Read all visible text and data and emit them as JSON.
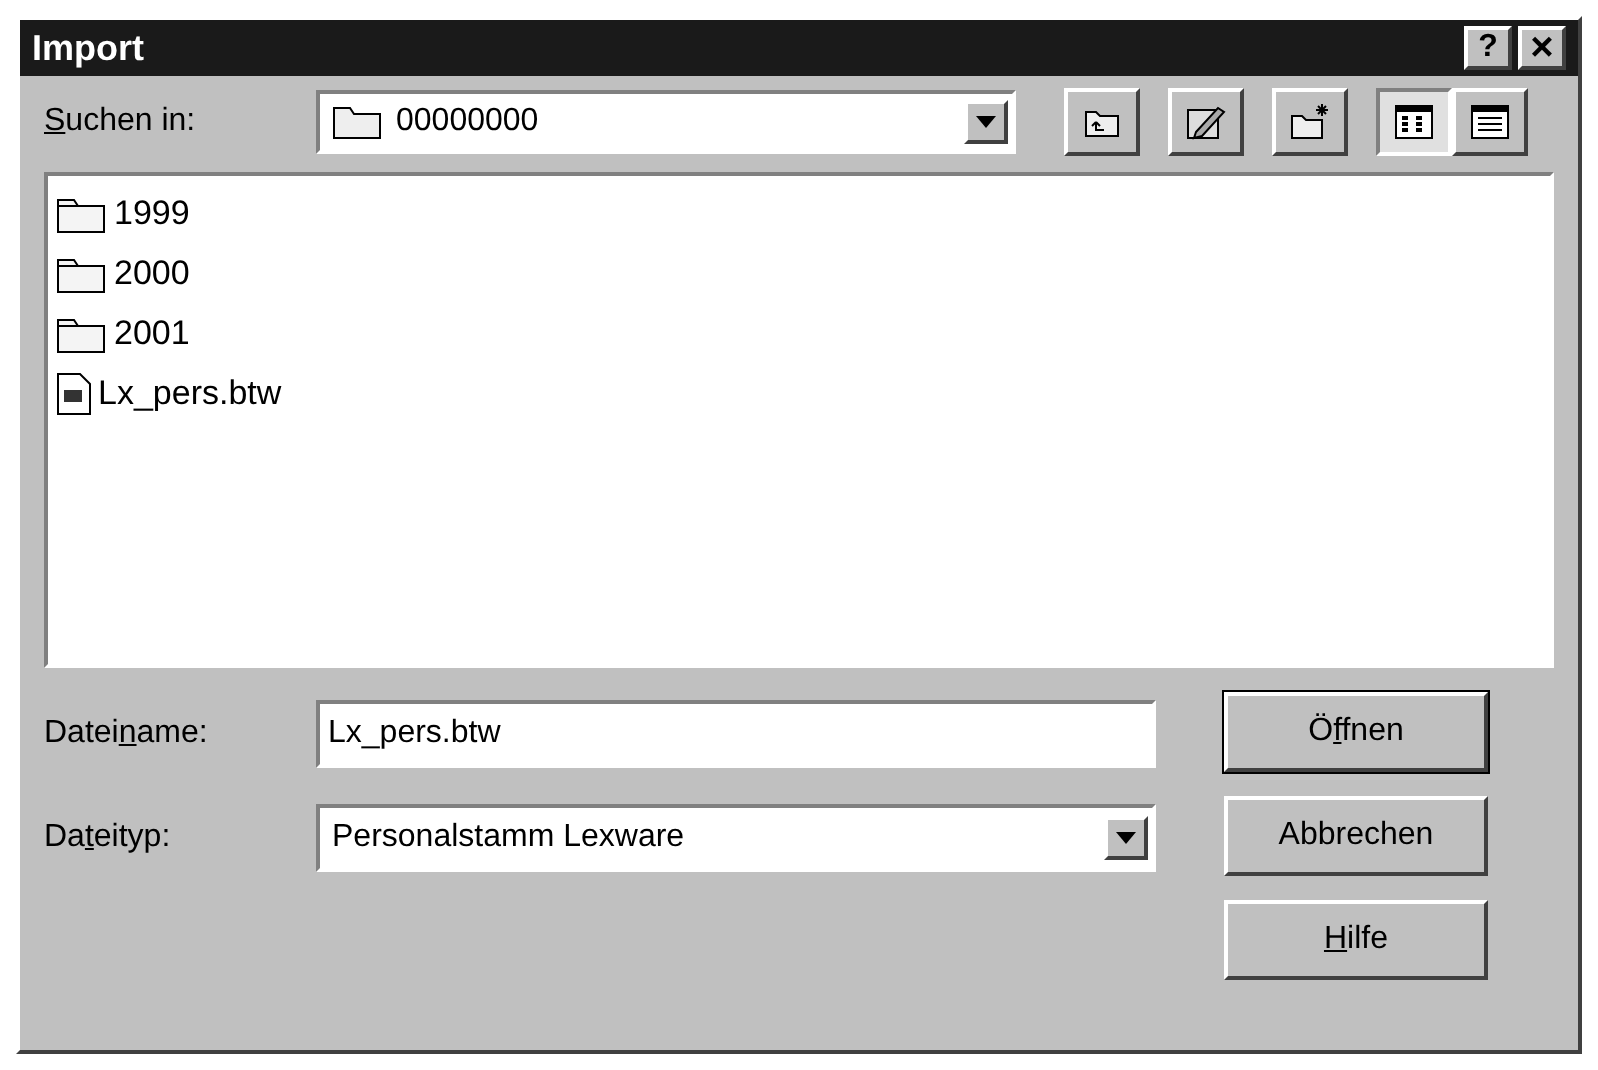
{
  "window": {
    "title": "Import",
    "help_button": "?",
    "close_button": "×"
  },
  "look_in": {
    "label": {
      "key": "S",
      "after": "uchen in:"
    },
    "value": "00000000"
  },
  "toolbar": [
    {
      "kind": "up",
      "selected": false
    },
    {
      "kind": "desktop",
      "selected": false
    },
    {
      "kind": "new-folder",
      "selected": false
    },
    {
      "kind": "list",
      "selected": true
    },
    {
      "kind": "details",
      "selected": false
    }
  ],
  "files": [
    {
      "kind": "folder",
      "name": "1999"
    },
    {
      "kind": "folder",
      "name": "2000"
    },
    {
      "kind": "folder",
      "name": "2001"
    },
    {
      "kind": "file",
      "name": "Lx_pers.btw"
    }
  ],
  "filename": {
    "label": {
      "before": "Datei",
      "key": "n",
      "after": "ame:"
    },
    "value": "Lx_pers.btw"
  },
  "filetype": {
    "label": {
      "before": "Da",
      "key": "t",
      "after": "eityp:"
    },
    "value": "Personalstamm Lexware"
  },
  "buttons": [
    {
      "before": "Ö",
      "key": "f",
      "after": "fnen",
      "default": true
    },
    {
      "before": "Abbrechen",
      "default": false
    },
    {
      "key": "H",
      "after": "ilfe",
      "default": false
    }
  ]
}
